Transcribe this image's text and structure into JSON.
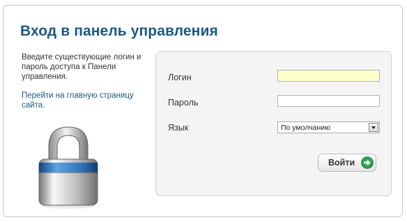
{
  "page": {
    "title": "Вход в панель управления",
    "description": "Введите существующие логин и пароль доступа к Панели управления.",
    "home_link": "Перейти на главную страницу сайта."
  },
  "form": {
    "login_label": "Логин",
    "login_value": "",
    "password_label": "Пароль",
    "password_value": "",
    "language_label": "Язык",
    "language_selected": "По умолчанию",
    "submit_label": "Войти"
  },
  "icons": {
    "lock": "lock-icon",
    "submit": "arrow-right-circle-icon"
  },
  "colors": {
    "title": "#1a5a83",
    "link": "#1a5a83",
    "active_input": "#ffffcc",
    "submit_icon": "#2ea44f"
  }
}
